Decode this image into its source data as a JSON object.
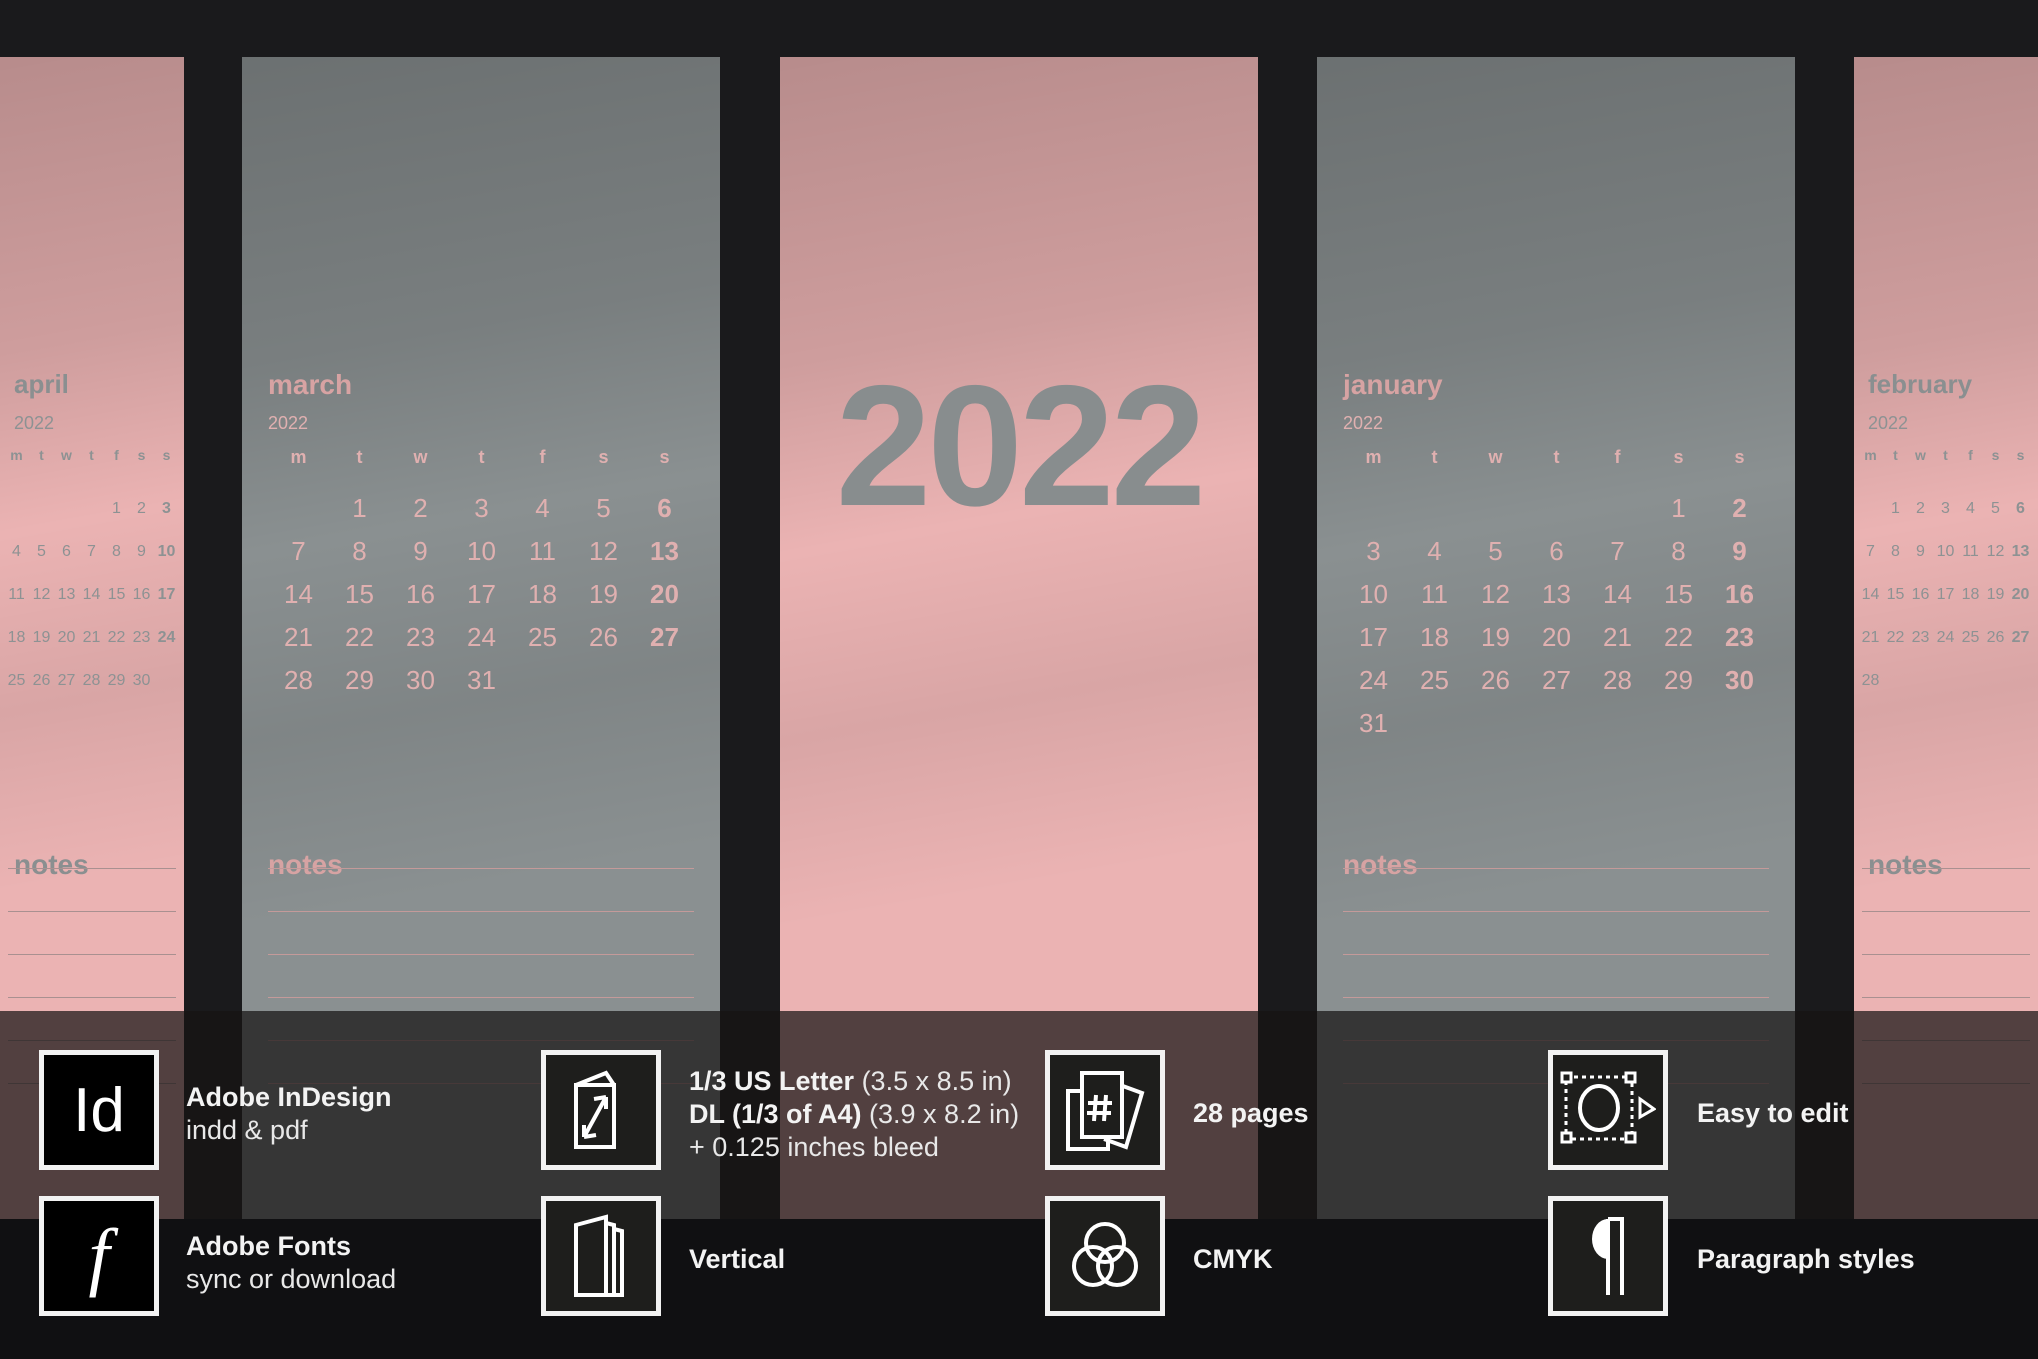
{
  "weekdays": [
    "m",
    "t",
    "w",
    "t",
    "f",
    "s",
    "s"
  ],
  "notes_label": "notes",
  "year_title": "2022",
  "colors": {
    "pink": "#ebb3b3",
    "gray": "#8a9091",
    "background": "#1a1a1c"
  },
  "months": [
    {
      "name": "april",
      "year": "2022",
      "theme": "pink",
      "weeks": [
        [
          "",
          "",
          "",
          "",
          "1",
          "2",
          "3"
        ],
        [
          "4",
          "5",
          "6",
          "7",
          "8",
          "9",
          "10"
        ],
        [
          "11",
          "12",
          "13",
          "14",
          "15",
          "16",
          "17"
        ],
        [
          "18",
          "19",
          "20",
          "21",
          "22",
          "23",
          "24"
        ],
        [
          "25",
          "26",
          "27",
          "28",
          "29",
          "30",
          ""
        ]
      ]
    },
    {
      "name": "march",
      "year": "2022",
      "theme": "gray",
      "weeks": [
        [
          "",
          "1",
          "2",
          "3",
          "4",
          "5",
          "6"
        ],
        [
          "7",
          "8",
          "9",
          "10",
          "11",
          "12",
          "13"
        ],
        [
          "14",
          "15",
          "16",
          "17",
          "18",
          "19",
          "20"
        ],
        [
          "21",
          "22",
          "23",
          "24",
          "25",
          "26",
          "27"
        ],
        [
          "28",
          "29",
          "30",
          "31",
          "",
          "",
          ""
        ]
      ]
    },
    {
      "name": "january",
      "year": "2022",
      "theme": "gray",
      "weeks": [
        [
          "",
          "",
          "",
          "",
          "",
          "1",
          "2"
        ],
        [
          "3",
          "4",
          "5",
          "6",
          "7",
          "8",
          "9"
        ],
        [
          "10",
          "11",
          "12",
          "13",
          "14",
          "15",
          "16"
        ],
        [
          "17",
          "18",
          "19",
          "20",
          "21",
          "22",
          "23"
        ],
        [
          "24",
          "25",
          "26",
          "27",
          "28",
          "29",
          "30"
        ],
        [
          "31",
          "",
          "",
          "",
          "",
          "",
          ""
        ]
      ]
    },
    {
      "name": "february",
      "year": "2022",
      "theme": "pink",
      "weeks": [
        [
          "",
          "1",
          "2",
          "3",
          "4",
          "5",
          "6"
        ],
        [
          "7",
          "8",
          "9",
          "10",
          "11",
          "12",
          "13"
        ],
        [
          "14",
          "15",
          "16",
          "17",
          "18",
          "19",
          "20"
        ],
        [
          "21",
          "22",
          "23",
          "24",
          "25",
          "26",
          "27"
        ],
        [
          "28",
          "",
          "",
          "",
          "",
          "",
          ""
        ]
      ]
    }
  ],
  "features": [
    {
      "icon": "indesign-icon",
      "glyph": "Id",
      "title": "Adobe InDesign",
      "subtitle": "indd & pdf"
    },
    {
      "icon": "adobe-fonts-icon",
      "glyph": "f",
      "title": "Adobe Fonts",
      "subtitle": "sync or download"
    },
    {
      "icon": "resize-page-icon",
      "line1_bold": "1/3 US Letter",
      "line1_light": " (3.5 x 8.5 in)",
      "line2_bold": "DL (1/3 of A4)",
      "line2_light": " (3.9 x 8.2 in)",
      "line3": "+ 0.125 inches bleed"
    },
    {
      "icon": "vertical-pages-icon",
      "title": "Vertical"
    },
    {
      "icon": "page-count-icon",
      "title": "28 pages"
    },
    {
      "icon": "cmyk-circles-icon",
      "title": "CMYK"
    },
    {
      "icon": "edit-selection-icon",
      "title": "Easy to edit"
    },
    {
      "icon": "pilcrow-icon",
      "title": "Paragraph styles"
    }
  ]
}
